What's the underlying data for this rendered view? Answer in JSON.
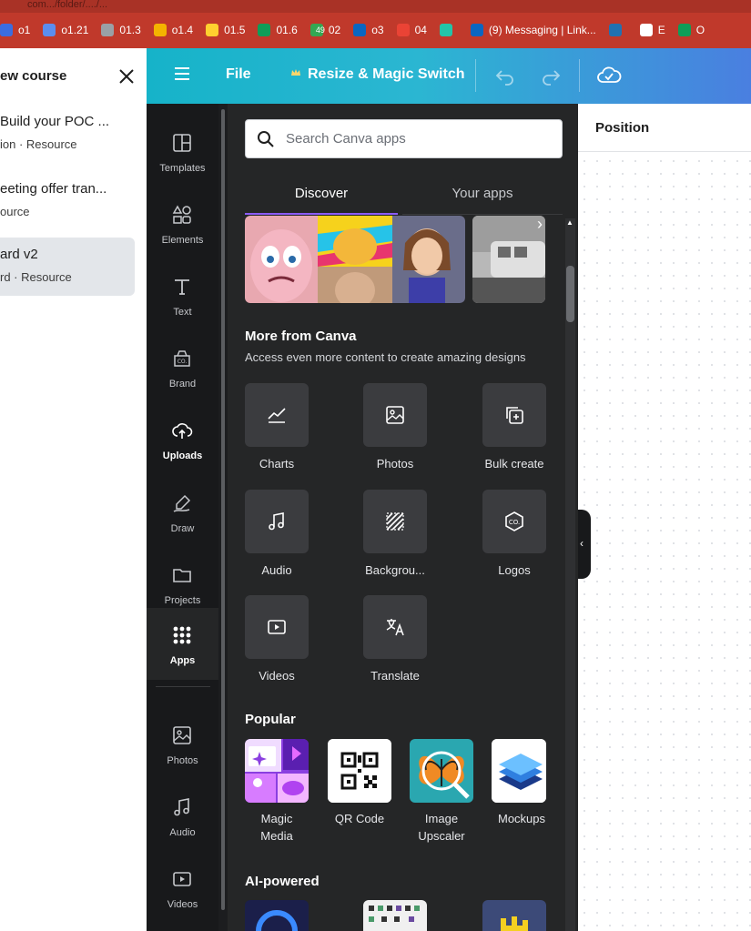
{
  "browser": {
    "url_fragment": "com.../folder/..../...",
    "bookmarks": [
      {
        "label": "o1",
        "icon": "shield-icon",
        "color": "#3b6de0"
      },
      {
        "label": "o1.21",
        "icon": "link-icon",
        "color": "#5b8def"
      },
      {
        "label": "01.3",
        "icon": "openai-icon",
        "color": "#9aa0a6"
      },
      {
        "label": "o1.4",
        "icon": "drive-icon",
        "color": "#f4b400"
      },
      {
        "label": "01.5",
        "icon": "miro-icon",
        "color": "#ffd02f"
      },
      {
        "label": "01.6",
        "icon": "sheets-plus-icon",
        "color": "#0f9d58"
      },
      {
        "label": "02",
        "icon": "badge-49-icon",
        "color": "#34a853",
        "badge": "49"
      },
      {
        "label": "o3",
        "icon": "linkedin-icon",
        "color": "#0a66c2"
      },
      {
        "label": "04",
        "icon": "gmail-icon",
        "color": "#ea4335"
      },
      {
        "label": "",
        "icon": "shield-check-icon",
        "color": "#23c4a8"
      },
      {
        "label": "(9) Messaging | Link...",
        "icon": "linkedin-icon",
        "color": "#0a66c2"
      },
      {
        "label": "",
        "icon": "wordpress-icon",
        "color": "#2271b1"
      },
      {
        "label": "E",
        "icon": "wix-icon",
        "color": "#ffffff"
      },
      {
        "label": "O",
        "icon": "sheets-plus-icon",
        "color": "#0f9d58"
      }
    ]
  },
  "left_panel": {
    "title": "ew course",
    "items": [
      {
        "title": "Build your POC ...",
        "meta": "ion · Resource",
        "active": false
      },
      {
        "title": "eeting offer tran...",
        "meta": "ource",
        "active": false
      },
      {
        "title": "ard v2",
        "meta": "rd · Resource",
        "active": true
      }
    ]
  },
  "topbar": {
    "file_label": "File",
    "resize_label": "Resize & Magic Switch"
  },
  "rail": {
    "items": [
      {
        "label": "Templates",
        "icon": "templates-icon"
      },
      {
        "label": "Elements",
        "icon": "elements-icon"
      },
      {
        "label": "Text",
        "icon": "text-icon"
      },
      {
        "label": "Brand",
        "icon": "brand-icon"
      },
      {
        "label": "Uploads",
        "icon": "upload-cloud-icon"
      },
      {
        "label": "Draw",
        "icon": "draw-icon"
      },
      {
        "label": "Projects",
        "icon": "folder-icon"
      },
      {
        "label": "Apps",
        "icon": "apps-grid-icon"
      },
      {
        "label": "Photos",
        "icon": "photo-icon"
      },
      {
        "label": "Audio",
        "icon": "music-note-icon"
      },
      {
        "label": "Videos",
        "icon": "video-icon"
      }
    ]
  },
  "apps_panel": {
    "search_placeholder": "Search Canva apps",
    "tabs": [
      {
        "label": "Discover",
        "active": true
      },
      {
        "label": "Your apps",
        "active": false
      }
    ],
    "more_title": "More from Canva",
    "more_subtitle": "Access even more content to create amazing designs",
    "more_items": [
      {
        "label": "Charts",
        "icon": "chart-line-icon"
      },
      {
        "label": "Photos",
        "icon": "photo-icon"
      },
      {
        "label": "Bulk create",
        "icon": "bulk-create-icon"
      },
      {
        "label": "Audio",
        "icon": "music-note-icon"
      },
      {
        "label": "Backgrou...",
        "icon": "background-stripes-icon"
      },
      {
        "label": "Logos",
        "icon": "logo-hex-icon"
      },
      {
        "label": "Videos",
        "icon": "video-icon"
      },
      {
        "label": "Translate",
        "icon": "translate-icon"
      }
    ],
    "popular_title": "Popular",
    "popular_items": [
      {
        "label": "Magic Media",
        "line1": "Magic",
        "line2": "Media"
      },
      {
        "label": "QR Code",
        "line1": "QR Code",
        "line2": ""
      },
      {
        "label": "Image Upscaler",
        "line1": "Image",
        "line2": "Upscaler"
      },
      {
        "label": "Mockups",
        "line1": "Mockups",
        "line2": ""
      }
    ],
    "ai_title": "AI-powered"
  },
  "right_panel": {
    "position_label": "Position"
  }
}
